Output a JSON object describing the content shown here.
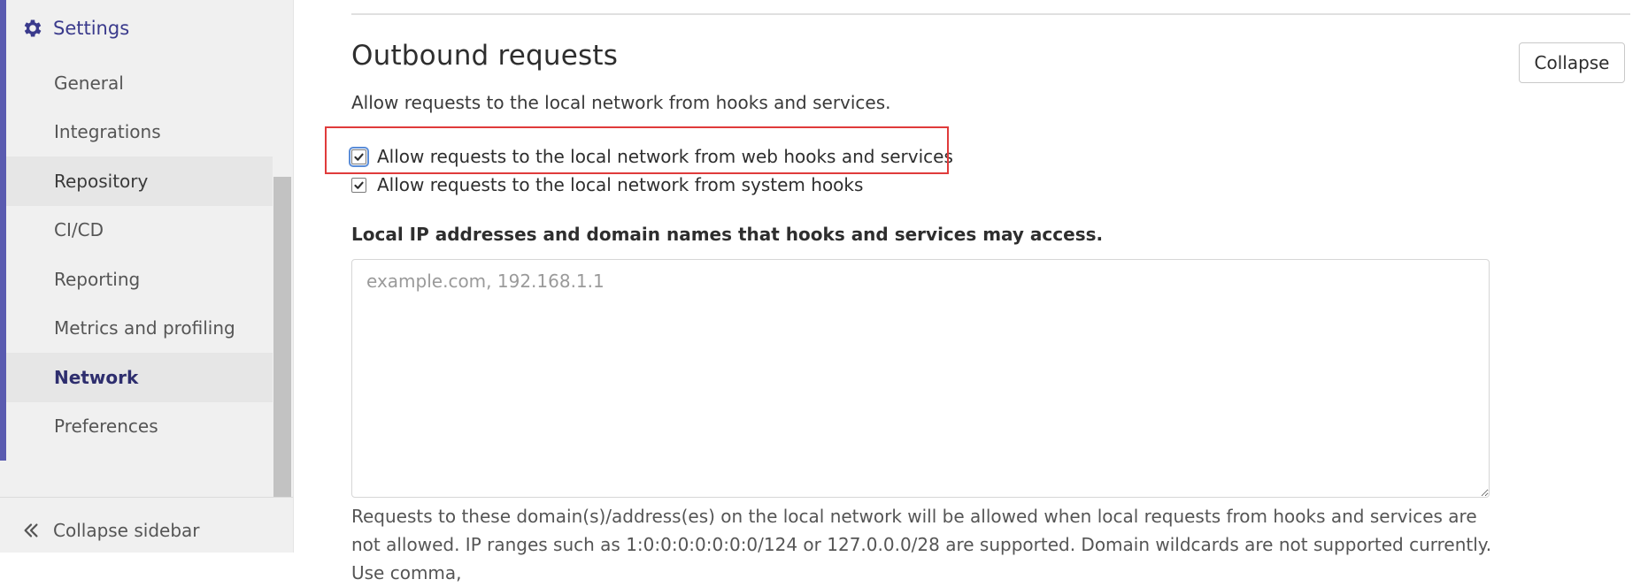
{
  "sidebar": {
    "header": {
      "label": "Settings",
      "icon": "gear-icon"
    },
    "items": [
      {
        "label": "General"
      },
      {
        "label": "Integrations"
      },
      {
        "label": "Repository"
      },
      {
        "label": "CI/CD"
      },
      {
        "label": "Reporting"
      },
      {
        "label": "Metrics and profiling"
      },
      {
        "label": "Network"
      },
      {
        "label": "Preferences"
      }
    ],
    "active_item": "Network",
    "collapse_label": "Collapse sidebar",
    "collapse_icon": "double-chevron-left-icon"
  },
  "section": {
    "title": "Outbound requests",
    "collapse_label": "Collapse",
    "description": "Allow requests to the local network from hooks and services.",
    "checkboxes": [
      {
        "label": "Allow requests to the local network from web hooks and services",
        "checked": true
      },
      {
        "label": "Allow requests to the local network from system hooks",
        "checked": true
      }
    ],
    "whitelist_label": "Local IP addresses and domain names that hooks and services may access.",
    "whitelist_value": "",
    "whitelist_placeholder": "example.com, 192.168.1.1",
    "help_text": "Requests to these domain(s)/address(es) on the local network will be allowed when local requests from hooks and services are not allowed. IP ranges such as 1:0:0:0:0:0:0:0/124 or 127.0.0.0/28 are supported. Domain wildcards are not supported currently. Use comma,"
  },
  "colors": {
    "accent": "#5a5bb0",
    "sidebar_active_text": "#2e2e6e",
    "highlight": "#e03b3b"
  }
}
